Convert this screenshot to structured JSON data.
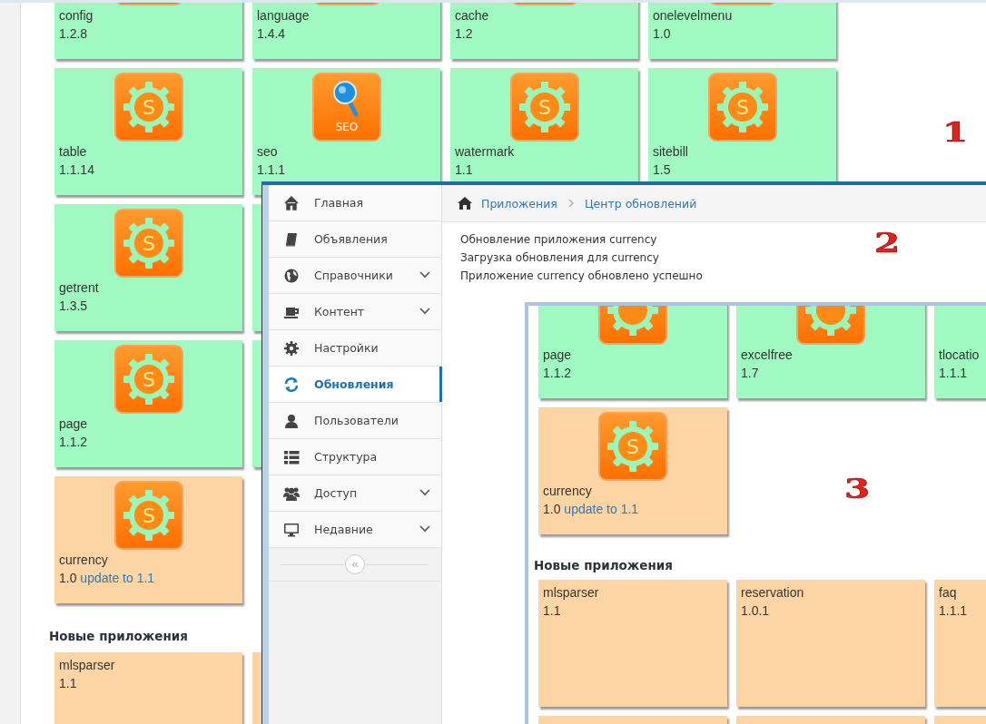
{
  "back_page": {
    "installed_rows": [
      [
        {
          "name": "config",
          "version": "1.2.8",
          "kind": "gear",
          "update_available": false
        },
        {
          "name": "language",
          "version": "1.4.4",
          "kind": "gear",
          "update_available": false
        },
        {
          "name": "cache",
          "version": "1.2",
          "kind": "gear",
          "update_available": false
        },
        {
          "name": "onelevelmenu",
          "version": "1.0",
          "kind": "gear",
          "update_available": false
        }
      ],
      [
        {
          "name": "table",
          "version": "1.1.14",
          "kind": "gear",
          "icon_label": "S",
          "update_available": false
        },
        {
          "name": "seo",
          "version": "1.1.1",
          "kind": "seo",
          "icon_label": "SEO",
          "update_available": false
        },
        {
          "name": "watermark",
          "version": "1.1",
          "kind": "gear",
          "icon_label": "S",
          "update_available": false
        },
        {
          "name": "sitebill",
          "version": "1.5",
          "kind": "gear",
          "icon_label": "S",
          "update_available": false
        }
      ],
      [
        {
          "name": "getrent",
          "version": "1.3.5",
          "kind": "gear",
          "icon_label": "S",
          "update_available": false
        },
        {
          "kind": "plain",
          "update_available": false
        }
      ],
      [
        {
          "name": "page",
          "version": "1.1.2",
          "kind": "gear",
          "icon_label": "S",
          "update_available": false
        },
        {
          "kind": "plain",
          "update_available": false
        }
      ],
      [
        {
          "name": "currency",
          "version": "1.0",
          "update_link": "update to 1.1",
          "kind": "gear",
          "icon_label": "S",
          "update_available": true
        }
      ]
    ],
    "new_apps_heading": "Новые приложения",
    "new_apps": [
      {
        "name": "mlsparser",
        "version": "1.1",
        "update_available": true
      },
      {
        "update_available": true
      }
    ],
    "annotation": "1"
  },
  "admin_window": {
    "sidebar": {
      "items": [
        {
          "label": "Главная",
          "expandable": false,
          "selected": false
        },
        {
          "label": "Объявления",
          "expandable": false,
          "selected": false
        },
        {
          "label": "Справочники",
          "expandable": true,
          "selected": false
        },
        {
          "label": "Контент",
          "expandable": true,
          "selected": false
        },
        {
          "label": "Настройки",
          "expandable": false,
          "selected": false
        },
        {
          "label": "Обновления",
          "expandable": false,
          "selected": true
        },
        {
          "label": "Пользователи",
          "expandable": false,
          "selected": false
        },
        {
          "label": "Структура",
          "expandable": false,
          "selected": false
        },
        {
          "label": "Доступ",
          "expandable": true,
          "selected": false
        },
        {
          "label": "Недавние",
          "expandable": true,
          "selected": false
        }
      ],
      "collapse_button": "«"
    },
    "breadcrumb": [
      "Приложения",
      "Центр обновлений"
    ],
    "messages": [
      "Обновление приложения currency",
      "Загрузка обновления для currency",
      "Приложение currency обновлено успешно"
    ],
    "annotation": "2"
  },
  "updates_window": {
    "installed_rows": [
      [
        {
          "name": "page",
          "version": "1.1.2",
          "kind": "gear",
          "update_available": false
        },
        {
          "name": "excelfree",
          "version": "1.7",
          "kind": "gear",
          "update_available": false
        },
        {
          "name": "tlocatio",
          "version": "1.1.1",
          "kind": "offscreen_icon",
          "update_available": false
        }
      ],
      [
        {
          "name": "currency",
          "version": "1.0",
          "update_link": "update to 1.1",
          "kind": "gear",
          "icon_label": "S",
          "update_available": true
        }
      ]
    ],
    "new_apps_heading": "Новые приложения",
    "new_apps": [
      {
        "name": "mlsparser",
        "version": "1.1",
        "update_available": true
      },
      {
        "name": "reservation",
        "version": "1.0.1",
        "update_available": true
      },
      {
        "name": "faq",
        "version": "1.1.1",
        "update_available": true
      },
      {
        "update_available": true
      },
      {
        "update_available": true
      },
      {
        "update_available": true
      }
    ],
    "annotation": "3"
  }
}
